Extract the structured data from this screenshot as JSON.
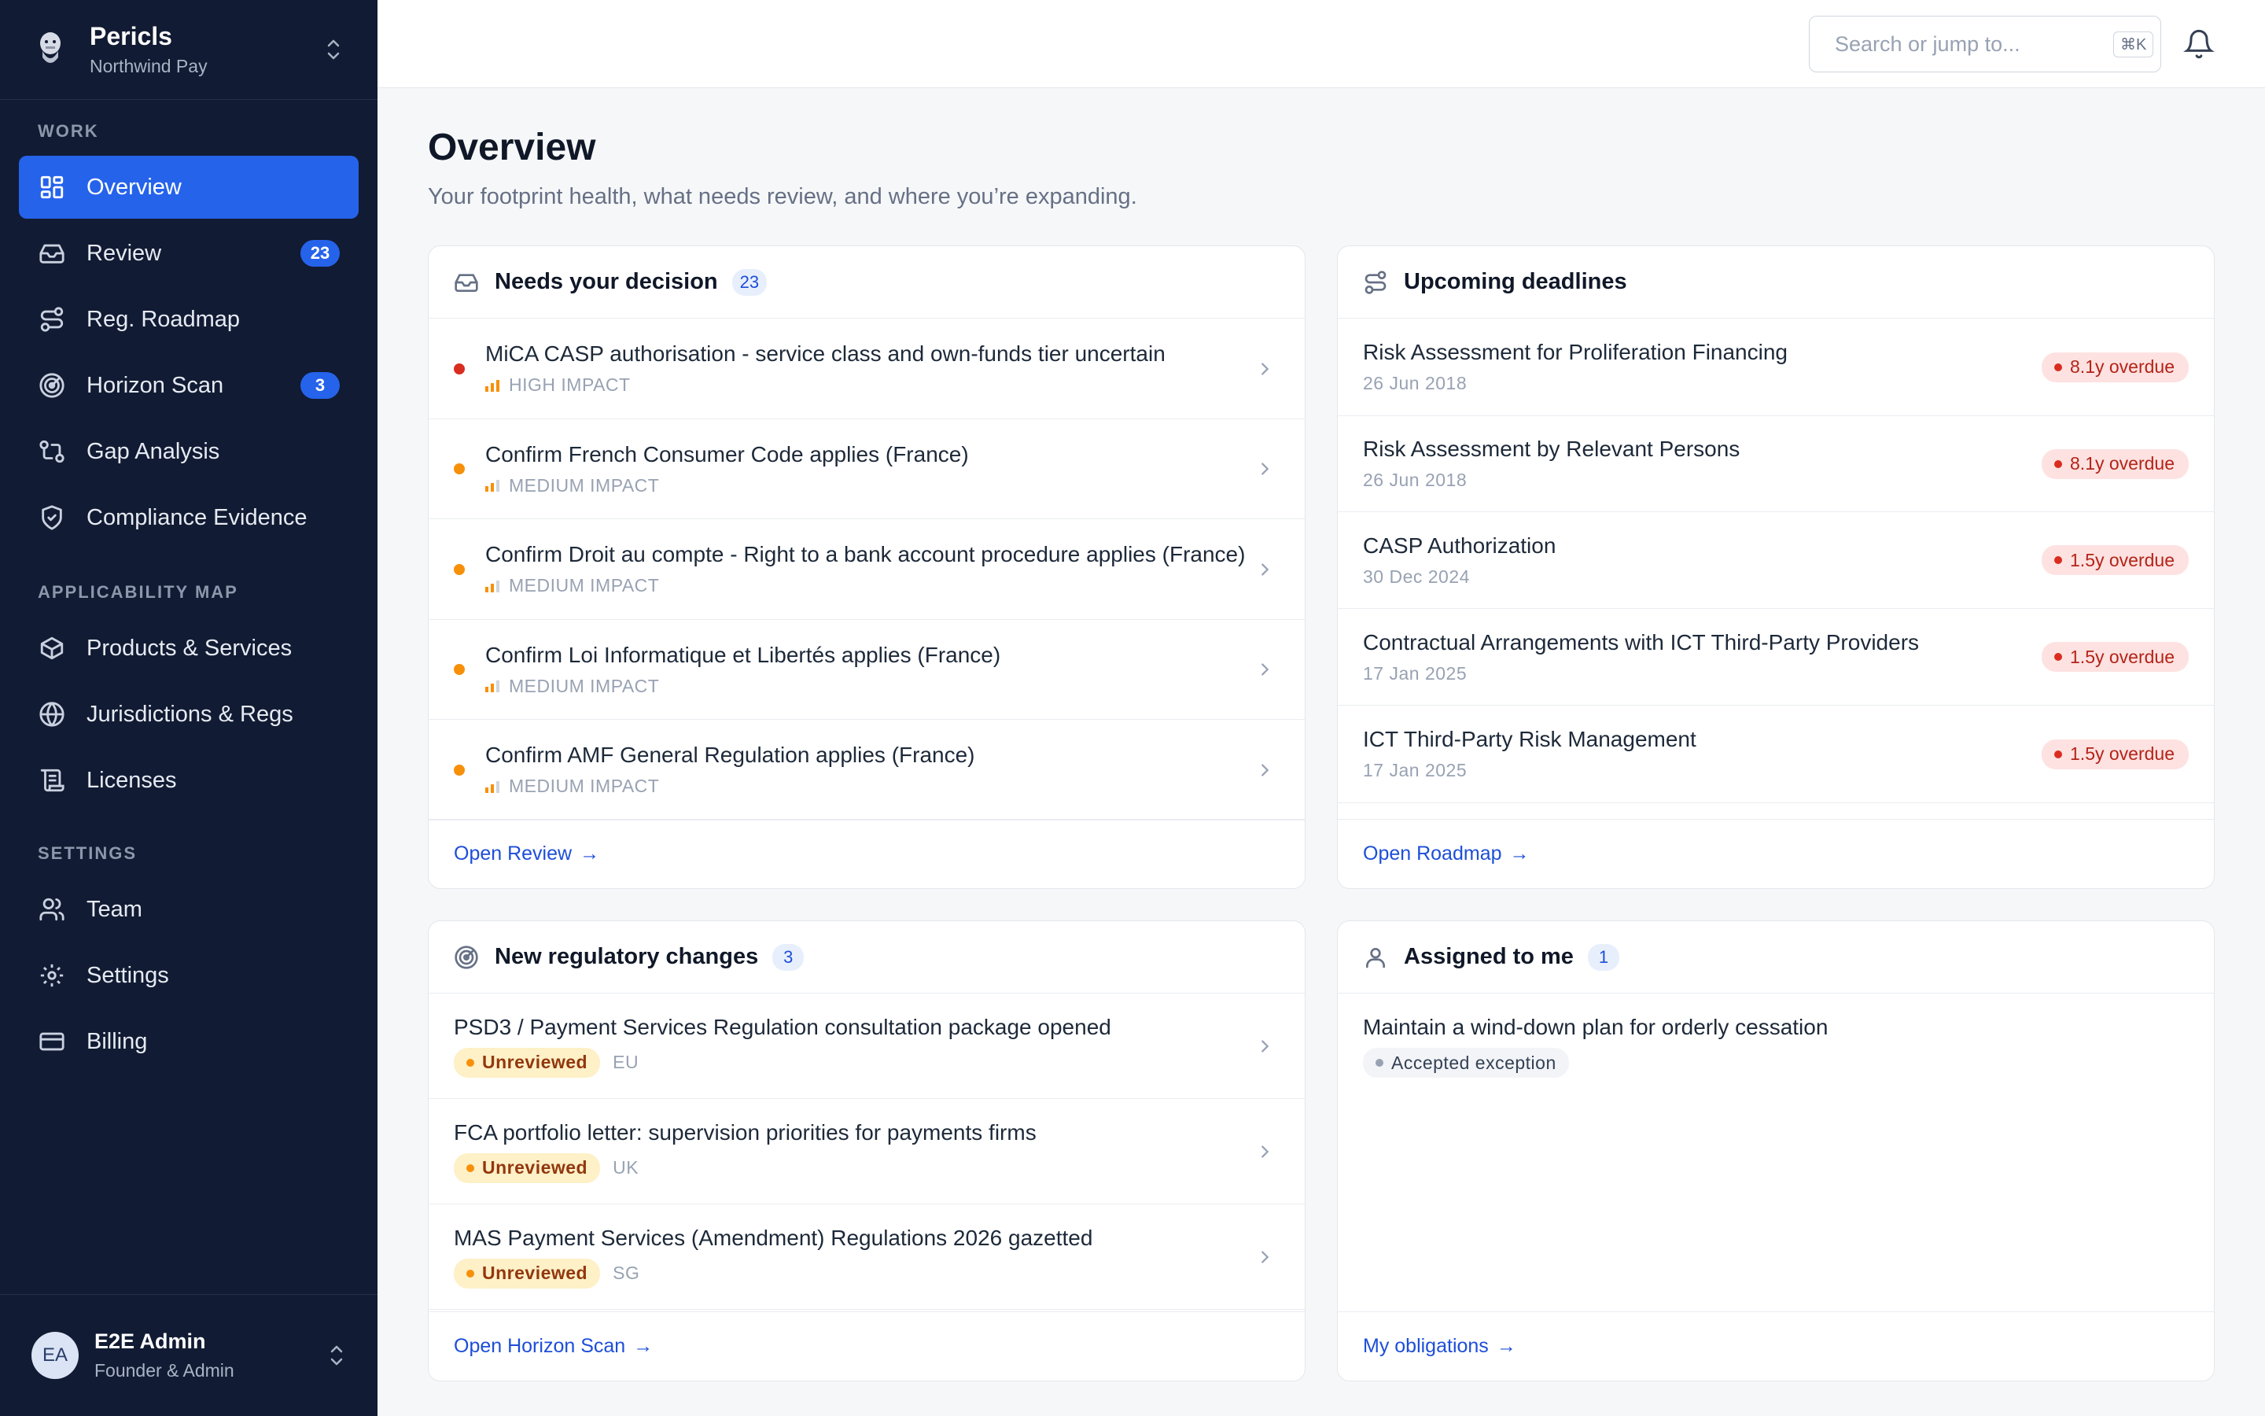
{
  "org": {
    "name": "Pericls",
    "subtitle": "Northwind Pay"
  },
  "sidebar": {
    "sections": {
      "work": "WORK",
      "applicability": "APPLICABILITY MAP",
      "settings": "SETTINGS"
    },
    "items": [
      {
        "label": "Overview",
        "icon": "grid-icon",
        "active": true
      },
      {
        "label": "Review",
        "icon": "inbox-icon",
        "badge": "23"
      },
      {
        "label": "Reg. Roadmap",
        "icon": "route-icon"
      },
      {
        "label": "Horizon Scan",
        "icon": "radar-icon",
        "badge": "3"
      },
      {
        "label": "Gap Analysis",
        "icon": "git-compare-icon"
      },
      {
        "label": "Compliance Evidence",
        "icon": "shield-check-icon"
      },
      {
        "label": "Products & Services",
        "icon": "box-icon"
      },
      {
        "label": "Jurisdictions & Regs",
        "icon": "globe-icon"
      },
      {
        "label": "Licenses",
        "icon": "scroll-icon"
      },
      {
        "label": "Team",
        "icon": "users-icon"
      },
      {
        "label": "Settings",
        "icon": "gear-icon"
      },
      {
        "label": "Billing",
        "icon": "credit-card-icon"
      }
    ]
  },
  "user": {
    "initials": "EA",
    "name": "E2E Admin",
    "role": "Founder & Admin"
  },
  "topbar": {
    "search_placeholder": "Search or jump to...",
    "shortcut": "⌘K"
  },
  "page": {
    "title": "Overview",
    "subtitle": "Your footprint health, what needs review, and where you’re expanding."
  },
  "decision": {
    "title": "Needs your decision",
    "count": "23",
    "items": [
      {
        "title": "MiCA CASP authorisation - service class and own-funds tier uncertain",
        "impact": "HIGH IMPACT",
        "color": "#d92d20"
      },
      {
        "title": "Confirm French Consumer Code applies (France)",
        "impact": "MEDIUM IMPACT",
        "color": "#f79009"
      },
      {
        "title": "Confirm Droit au compte - Right to a bank account procedure applies (France)",
        "impact": "MEDIUM IMPACT",
        "color": "#f79009"
      },
      {
        "title": "Confirm Loi Informatique et Libertés applies (France)",
        "impact": "MEDIUM IMPACT",
        "color": "#f79009"
      },
      {
        "title": "Confirm AMF General Regulation applies (France)",
        "impact": "MEDIUM IMPACT",
        "color": "#f79009"
      }
    ],
    "link": "Open Review"
  },
  "deadlines": {
    "title": "Upcoming deadlines",
    "items": [
      {
        "title": "Risk Assessment for Proliferation Financing",
        "date": "26 Jun 2018",
        "status": "8.1y overdue"
      },
      {
        "title": "Risk Assessment by Relevant Persons",
        "date": "26 Jun 2018",
        "status": "8.1y overdue"
      },
      {
        "title": "CASP Authorization",
        "date": "30 Dec 2024",
        "status": "1.5y overdue"
      },
      {
        "title": "Contractual Arrangements with ICT Third-Party Providers",
        "date": "17 Jan 2025",
        "status": "1.5y overdue"
      },
      {
        "title": "ICT Third-Party Risk Management",
        "date": "17 Jan 2025",
        "status": "1.5y overdue"
      }
    ],
    "link": "Open Roadmap"
  },
  "changes": {
    "title": "New regulatory changes",
    "count": "3",
    "items": [
      {
        "title": "PSD3 / Payment Services Regulation consultation package opened",
        "status": "Unreviewed",
        "region": "EU"
      },
      {
        "title": "FCA portfolio letter: supervision priorities for payments firms",
        "status": "Unreviewed",
        "region": "UK"
      },
      {
        "title": "MAS Payment Services (Amendment) Regulations 2026 gazetted",
        "status": "Unreviewed",
        "region": "SG"
      }
    ],
    "link": "Open Horizon Scan"
  },
  "assigned": {
    "title": "Assigned to me",
    "count": "1",
    "items": [
      {
        "title": "Maintain a wind-down plan for orderly cessation",
        "status": "Accepted exception"
      }
    ],
    "link": "My obligations"
  },
  "colors": {
    "sidebar_bg": "#111b33",
    "accent": "#2563eb",
    "overdue": "#d92d20",
    "medium": "#f79009"
  }
}
